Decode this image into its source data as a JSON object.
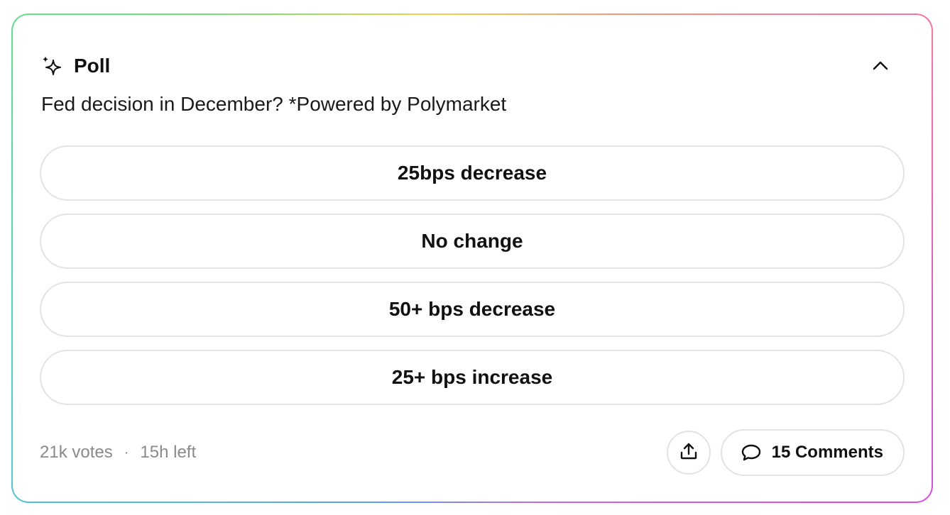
{
  "poll": {
    "title": "Poll",
    "question": "Fed decision in December? *Powered by Polymarket",
    "options": [
      {
        "label": "25bps decrease"
      },
      {
        "label": "No change"
      },
      {
        "label": "50+ bps decrease"
      },
      {
        "label": "25+ bps increase"
      }
    ],
    "votes": "21k votes",
    "separator": "·",
    "time_left": "15h left",
    "comments_label": "15 Comments"
  },
  "icons": {
    "header": "sparkle-icon",
    "collapse": "chevron-up-icon",
    "share": "share-upload-icon",
    "comments": "speech-bubble-icon"
  },
  "colors": {
    "border_gradient": [
      "#5b9df0",
      "#4fd3c4",
      "#6be07a",
      "#f2d24a",
      "#f59a7a",
      "#ef6fa8",
      "#d64fe0"
    ],
    "muted_text": "#8a8a8a",
    "option_border": "#e3e3e3"
  }
}
